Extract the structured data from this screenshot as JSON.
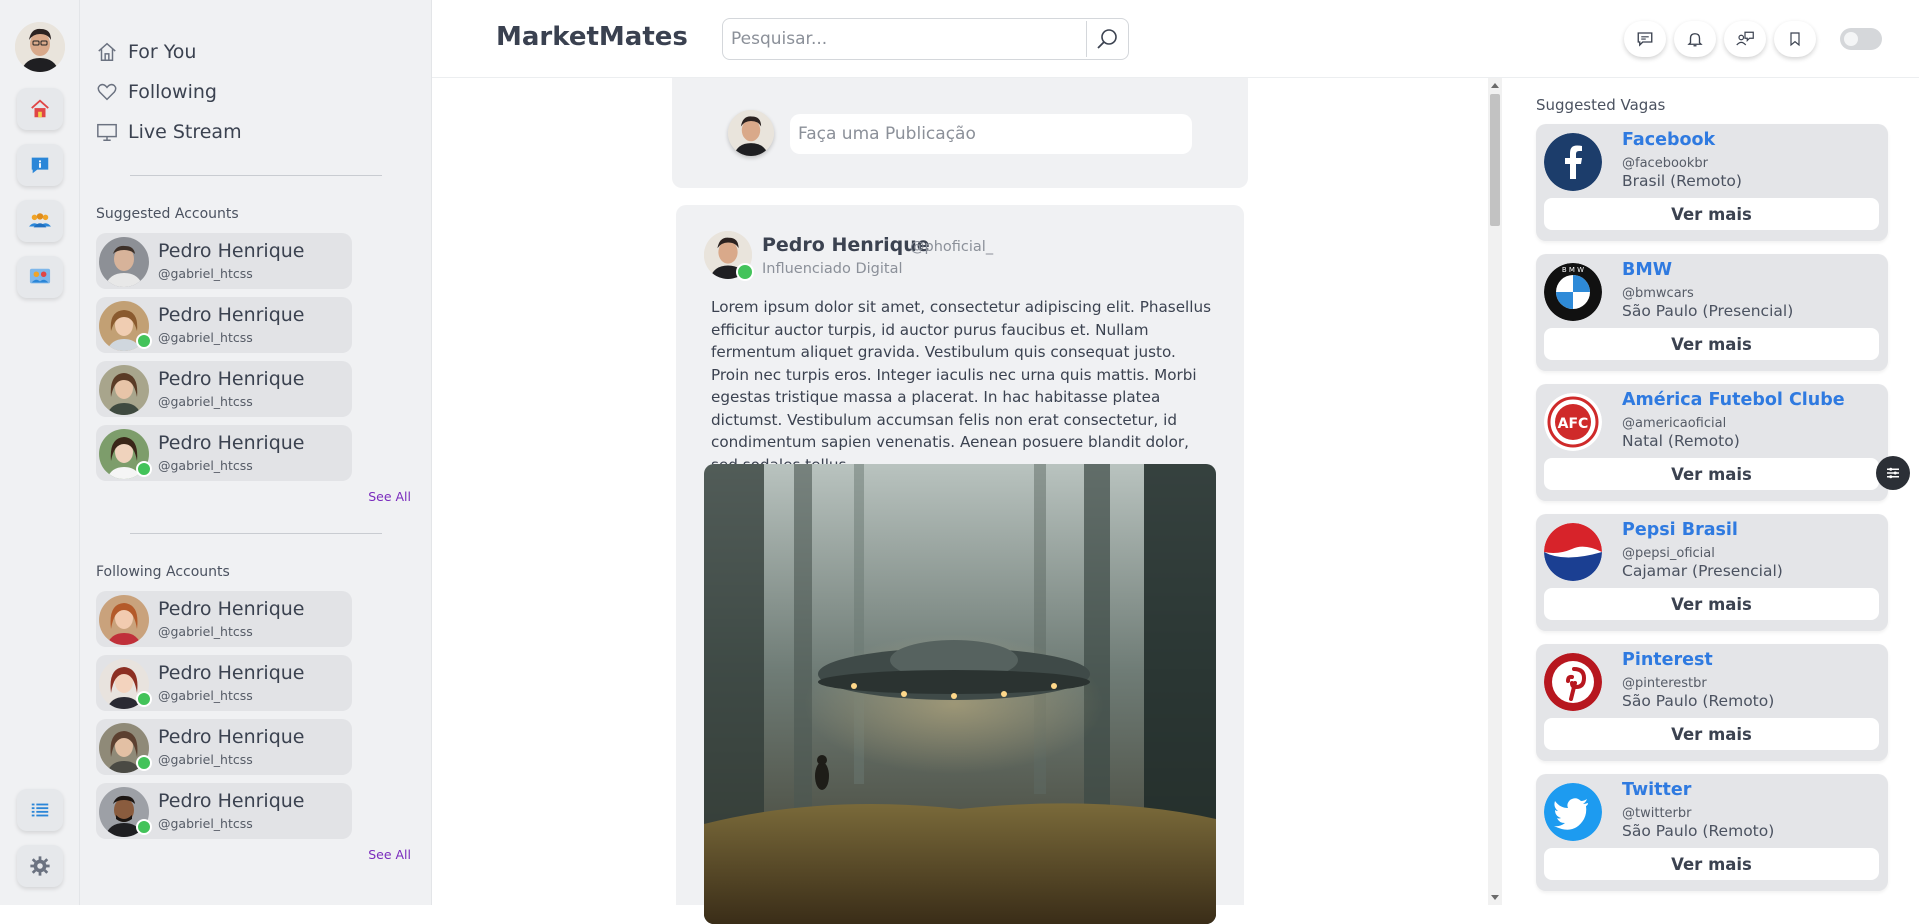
{
  "app": {
    "brand": "MarketMates"
  },
  "search": {
    "placeholder": "Pesquisar..."
  },
  "rail": {
    "icons": [
      "home-icon",
      "info-icon",
      "group-icon",
      "team-icon",
      "list-icon",
      "gear-icon"
    ],
    "colors": {
      "home": "#e04646",
      "info": "#2a86d8",
      "group": "#f0a428",
      "team": "#2a86d8",
      "list": "#2a86d8",
      "gear": "#6b7280"
    }
  },
  "nav": [
    {
      "label": "For You",
      "icon": "home-outline-icon"
    },
    {
      "label": "Following",
      "icon": "heart-outline-icon"
    },
    {
      "label": "Live Stream",
      "icon": "monitor-icon"
    }
  ],
  "suggested_accounts": {
    "title": "Suggested Accounts",
    "see_all": "See All",
    "items": [
      {
        "name": "Pedro Henrique",
        "handle": "@gabriel_htcss",
        "verified": false
      },
      {
        "name": "Pedro Henrique",
        "handle": "@gabriel_htcss",
        "verified": true
      },
      {
        "name": "Pedro Henrique",
        "handle": "@gabriel_htcss",
        "verified": false
      },
      {
        "name": "Pedro Henrique",
        "handle": "@gabriel_htcss",
        "verified": true
      }
    ]
  },
  "following_accounts": {
    "title": "Following Accounts",
    "see_all": "See All",
    "items": [
      {
        "name": "Pedro Henrique",
        "handle": "@gabriel_htcss",
        "verified": false
      },
      {
        "name": "Pedro Henrique",
        "handle": "@gabriel_htcss",
        "verified": true
      },
      {
        "name": "Pedro Henrique",
        "handle": "@gabriel_htcss",
        "verified": true
      },
      {
        "name": "Pedro Henrique",
        "handle": "@gabriel_htcss",
        "verified": true
      }
    ]
  },
  "header_actions": [
    "chat-icon",
    "bell-icon",
    "people-chat-icon",
    "bookmark-icon",
    "theme-toggle"
  ],
  "composer": {
    "placeholder": "Faça uma Publicação"
  },
  "post": {
    "author": "Pedro Henrique",
    "handle": "@phoficial_",
    "role": "Influenciado Digital",
    "verified": true,
    "text": "Lorem ipsum dolor sit amet, consectetur adipiscing elit. Phasellus efficitur auctor turpis, id auctor purus faucibus et. Nullam fermentum aliquet gravida. Vestibulum quis consequat justo. Proin nec turpis eros. Integer iaculis nec urna quis mattis. Morbi egestas tristique massa a placerat. In hac habitasse platea dictumst. Vestibulum accumsan felis non erat consectetur, id condimentum sapien venenatis. Aenean posuere blandit dolor, sed sodales tellus."
  },
  "vagas": {
    "title": "Suggested Vagas",
    "button": "Ver mais",
    "items": [
      {
        "name": "Facebook",
        "handle": "@facebookbr",
        "location": "Brasil (Remoto)",
        "logo": "facebook-logo"
      },
      {
        "name": "BMW",
        "handle": "@bmwcars",
        "location": "São Paulo (Presencial)",
        "logo": "bmw-logo",
        "logo_text": "B M W"
      },
      {
        "name": "América Futebol Clube",
        "handle": "@americaoficial",
        "location": "Natal (Remoto)",
        "logo": "america-logo",
        "logo_text": "AFC"
      },
      {
        "name": "Pepsi Brasil",
        "handle": "@pepsi_oficial",
        "location": "Cajamar (Presencial)",
        "logo": "pepsi-logo"
      },
      {
        "name": "Pinterest",
        "handle": "@pinterestbr",
        "location": "São Paulo (Remoto)",
        "logo": "pinterest-logo"
      },
      {
        "name": "Twitter",
        "handle": "@twitterbr",
        "location": "São Paulo (Remoto)",
        "logo": "twitter-logo"
      }
    ]
  }
}
